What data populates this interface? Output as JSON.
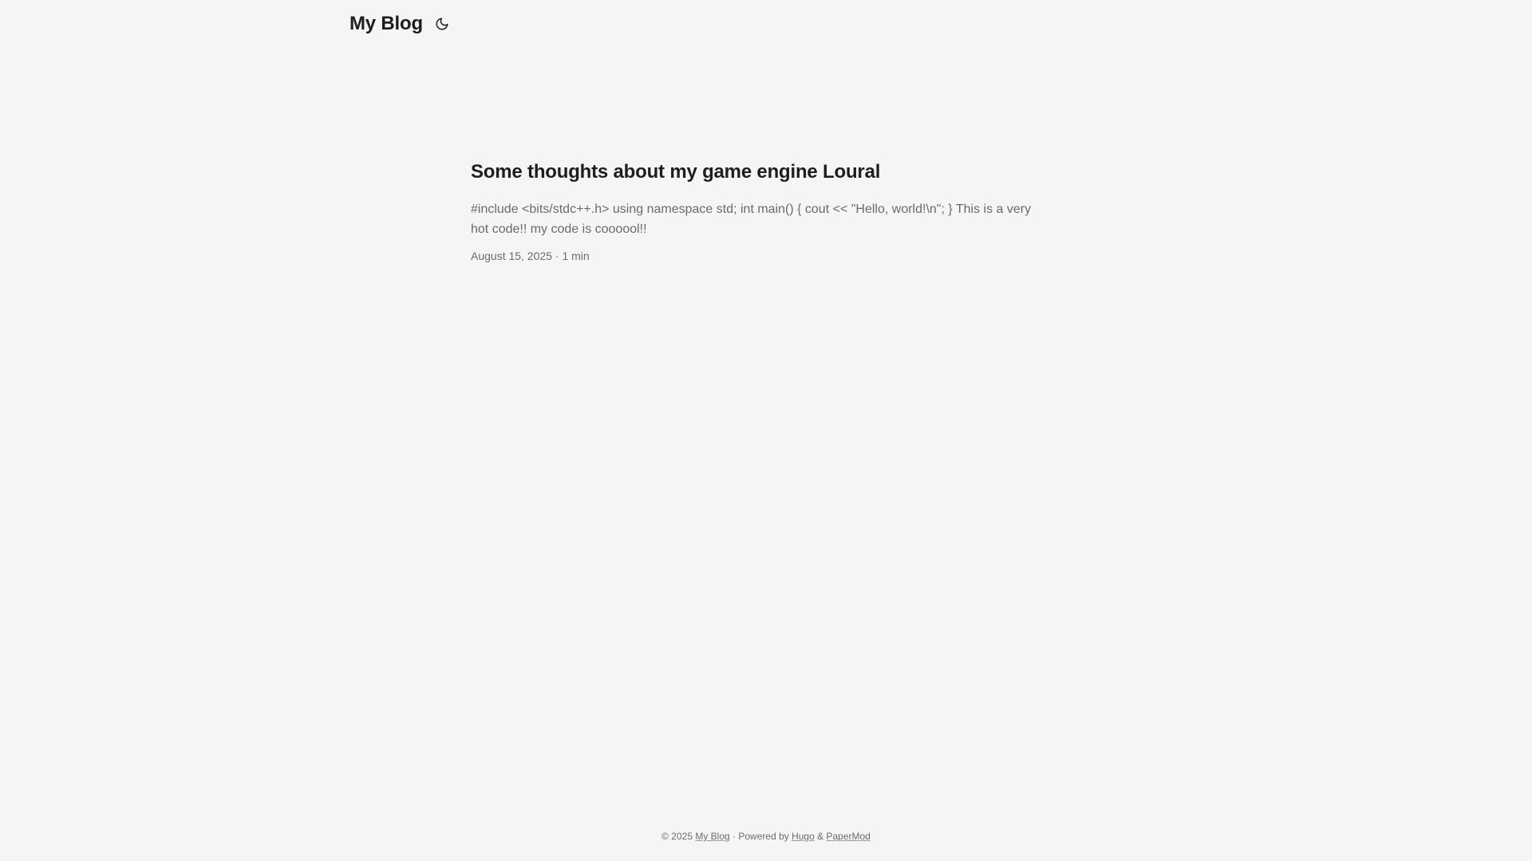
{
  "header": {
    "logo": "My Blog",
    "theme_toggle_icon": "moon-icon"
  },
  "post": {
    "title": "Some thoughts about my game engine Loural",
    "summary": "#include <bits/stdc++.h> using namespace std; int main() { cout << \"Hello, world!\\n\"; } This is a very hot code!! my code is coooool!!",
    "date": "August 15, 2025",
    "separator": " · ",
    "reading_time": "1 min"
  },
  "footer": {
    "copyright": "© 2025",
    "site_link": "My Blog",
    "separator": " · ",
    "powered_by": "Powered by",
    "hugo_link": "Hugo",
    "ampersand": "&",
    "theme_link": "PaperMod"
  },
  "colors": {
    "background": "#f5f5f5",
    "primary_text": "#1e1e1e",
    "secondary_text": "#6b6b6b"
  }
}
